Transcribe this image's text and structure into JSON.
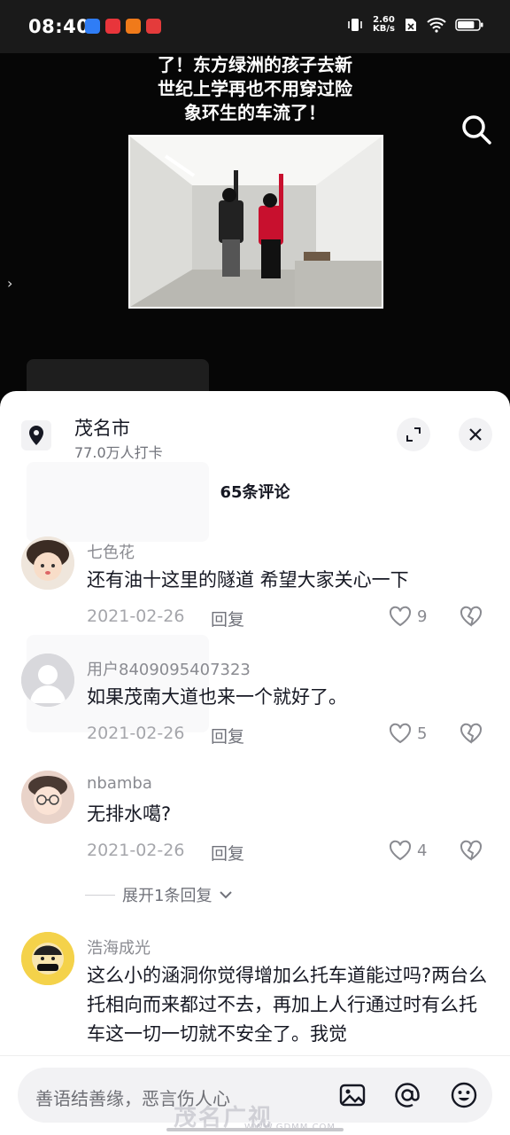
{
  "status_bar": {
    "time": "08:40",
    "net_speed_value": "2.60",
    "net_speed_unit": "KB/s",
    "battery_level": 0.8
  },
  "video": {
    "caption": "了！东方绿洲的孩子去新\n世纪上学再也不用穿过险\n象环生的车流了！"
  },
  "sheet": {
    "location_name": "茂名市",
    "location_checkins": "77.0万人打卡",
    "comment_count": "65条评论"
  },
  "comments": [
    {
      "username": "七色花",
      "text": "还有油十这里的隧道 希望大家关心一下",
      "date": "2021-02-26",
      "reply_label": "回复",
      "likes": "9"
    },
    {
      "username": "用户8409095407323",
      "text": "如果茂南大道也来一个就好了。",
      "date": "2021-02-26",
      "reply_label": "回复",
      "likes": "5"
    },
    {
      "username": "nbamba",
      "text": "无排水噶?",
      "date": "2021-02-26",
      "reply_label": "回复",
      "likes": "4",
      "expand_label": "展开1条回复"
    },
    {
      "username": "浩海成光",
      "text": "这么小的涵洞你觉得增加么托车道能过吗?两台么托相向而来都过不去，再加上人行通过时有么托车这一切一切就不安全了。我觉"
    }
  ],
  "input_bar": {
    "placeholder": "善语结善缘，恶言伤人心"
  },
  "watermark": {
    "main": "茂名广视",
    "sub": "WWW.GDMM.COM"
  },
  "colors": {
    "accent_red": "#fe2c55",
    "text_primary": "#161823",
    "text_secondary": "#8a8b91"
  }
}
